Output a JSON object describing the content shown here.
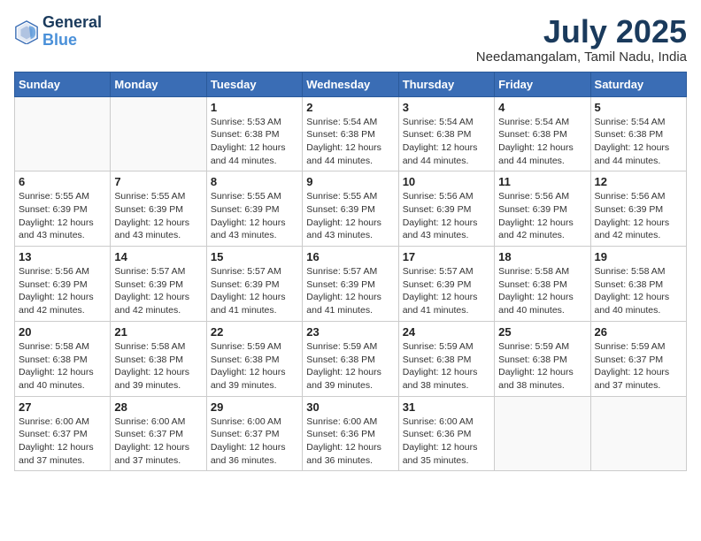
{
  "header": {
    "logo_line1": "General",
    "logo_line2": "Blue",
    "month_year": "July 2025",
    "location": "Needamangalam, Tamil Nadu, India"
  },
  "weekdays": [
    "Sunday",
    "Monday",
    "Tuesday",
    "Wednesday",
    "Thursday",
    "Friday",
    "Saturday"
  ],
  "weeks": [
    [
      {
        "day": "",
        "info": ""
      },
      {
        "day": "",
        "info": ""
      },
      {
        "day": "1",
        "info": "Sunrise: 5:53 AM\nSunset: 6:38 PM\nDaylight: 12 hours and 44 minutes."
      },
      {
        "day": "2",
        "info": "Sunrise: 5:54 AM\nSunset: 6:38 PM\nDaylight: 12 hours and 44 minutes."
      },
      {
        "day": "3",
        "info": "Sunrise: 5:54 AM\nSunset: 6:38 PM\nDaylight: 12 hours and 44 minutes."
      },
      {
        "day": "4",
        "info": "Sunrise: 5:54 AM\nSunset: 6:38 PM\nDaylight: 12 hours and 44 minutes."
      },
      {
        "day": "5",
        "info": "Sunrise: 5:54 AM\nSunset: 6:38 PM\nDaylight: 12 hours and 44 minutes."
      }
    ],
    [
      {
        "day": "6",
        "info": "Sunrise: 5:55 AM\nSunset: 6:39 PM\nDaylight: 12 hours and 43 minutes."
      },
      {
        "day": "7",
        "info": "Sunrise: 5:55 AM\nSunset: 6:39 PM\nDaylight: 12 hours and 43 minutes."
      },
      {
        "day": "8",
        "info": "Sunrise: 5:55 AM\nSunset: 6:39 PM\nDaylight: 12 hours and 43 minutes."
      },
      {
        "day": "9",
        "info": "Sunrise: 5:55 AM\nSunset: 6:39 PM\nDaylight: 12 hours and 43 minutes."
      },
      {
        "day": "10",
        "info": "Sunrise: 5:56 AM\nSunset: 6:39 PM\nDaylight: 12 hours and 43 minutes."
      },
      {
        "day": "11",
        "info": "Sunrise: 5:56 AM\nSunset: 6:39 PM\nDaylight: 12 hours and 42 minutes."
      },
      {
        "day": "12",
        "info": "Sunrise: 5:56 AM\nSunset: 6:39 PM\nDaylight: 12 hours and 42 minutes."
      }
    ],
    [
      {
        "day": "13",
        "info": "Sunrise: 5:56 AM\nSunset: 6:39 PM\nDaylight: 12 hours and 42 minutes."
      },
      {
        "day": "14",
        "info": "Sunrise: 5:57 AM\nSunset: 6:39 PM\nDaylight: 12 hours and 42 minutes."
      },
      {
        "day": "15",
        "info": "Sunrise: 5:57 AM\nSunset: 6:39 PM\nDaylight: 12 hours and 41 minutes."
      },
      {
        "day": "16",
        "info": "Sunrise: 5:57 AM\nSunset: 6:39 PM\nDaylight: 12 hours and 41 minutes."
      },
      {
        "day": "17",
        "info": "Sunrise: 5:57 AM\nSunset: 6:39 PM\nDaylight: 12 hours and 41 minutes."
      },
      {
        "day": "18",
        "info": "Sunrise: 5:58 AM\nSunset: 6:38 PM\nDaylight: 12 hours and 40 minutes."
      },
      {
        "day": "19",
        "info": "Sunrise: 5:58 AM\nSunset: 6:38 PM\nDaylight: 12 hours and 40 minutes."
      }
    ],
    [
      {
        "day": "20",
        "info": "Sunrise: 5:58 AM\nSunset: 6:38 PM\nDaylight: 12 hours and 40 minutes."
      },
      {
        "day": "21",
        "info": "Sunrise: 5:58 AM\nSunset: 6:38 PM\nDaylight: 12 hours and 39 minutes."
      },
      {
        "day": "22",
        "info": "Sunrise: 5:59 AM\nSunset: 6:38 PM\nDaylight: 12 hours and 39 minutes."
      },
      {
        "day": "23",
        "info": "Sunrise: 5:59 AM\nSunset: 6:38 PM\nDaylight: 12 hours and 39 minutes."
      },
      {
        "day": "24",
        "info": "Sunrise: 5:59 AM\nSunset: 6:38 PM\nDaylight: 12 hours and 38 minutes."
      },
      {
        "day": "25",
        "info": "Sunrise: 5:59 AM\nSunset: 6:38 PM\nDaylight: 12 hours and 38 minutes."
      },
      {
        "day": "26",
        "info": "Sunrise: 5:59 AM\nSunset: 6:37 PM\nDaylight: 12 hours and 37 minutes."
      }
    ],
    [
      {
        "day": "27",
        "info": "Sunrise: 6:00 AM\nSunset: 6:37 PM\nDaylight: 12 hours and 37 minutes."
      },
      {
        "day": "28",
        "info": "Sunrise: 6:00 AM\nSunset: 6:37 PM\nDaylight: 12 hours and 37 minutes."
      },
      {
        "day": "29",
        "info": "Sunrise: 6:00 AM\nSunset: 6:37 PM\nDaylight: 12 hours and 36 minutes."
      },
      {
        "day": "30",
        "info": "Sunrise: 6:00 AM\nSunset: 6:36 PM\nDaylight: 12 hours and 36 minutes."
      },
      {
        "day": "31",
        "info": "Sunrise: 6:00 AM\nSunset: 6:36 PM\nDaylight: 12 hours and 35 minutes."
      },
      {
        "day": "",
        "info": ""
      },
      {
        "day": "",
        "info": ""
      }
    ]
  ]
}
